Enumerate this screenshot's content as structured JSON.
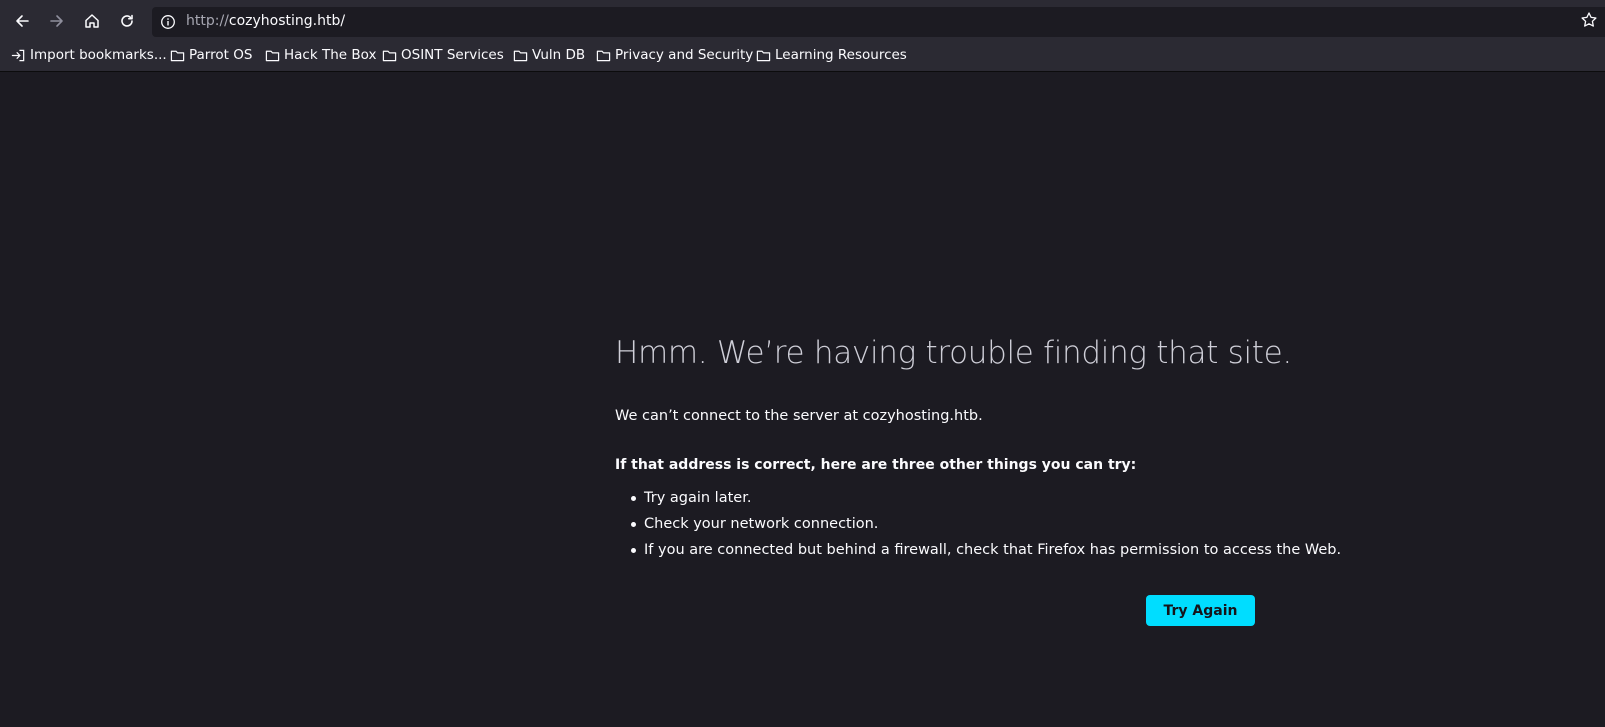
{
  "browser": {
    "url_protocol": "http://",
    "url_host": "cozyhosting.htb/",
    "bookmarks": [
      {
        "label": "Import bookmarks...",
        "icon": "import-icon"
      },
      {
        "label": "Parrot OS",
        "icon": "folder-icon"
      },
      {
        "label": "Hack The Box",
        "icon": "folder-icon"
      },
      {
        "label": "OSINT Services",
        "icon": "folder-icon"
      },
      {
        "label": "Vuln DB",
        "icon": "folder-icon"
      },
      {
        "label": "Privacy and Security",
        "icon": "folder-icon"
      },
      {
        "label": "Learning Resources",
        "icon": "folder-icon"
      }
    ]
  },
  "error": {
    "title": "Hmm. We’re having trouble finding that site.",
    "description": "We can’t connect to the server at cozyhosting.htb.",
    "subheading": "If that address is correct, here are three other things you can try:",
    "tips": [
      "Try again later.",
      "Check your network connection.",
      "If you are connected but behind a firewall, check that Firefox has permission to access the Web."
    ],
    "button_label": "Try Again"
  },
  "colors": {
    "background": "#1c1b22",
    "toolbar": "#2b2a33",
    "accent": "#00ddff"
  }
}
